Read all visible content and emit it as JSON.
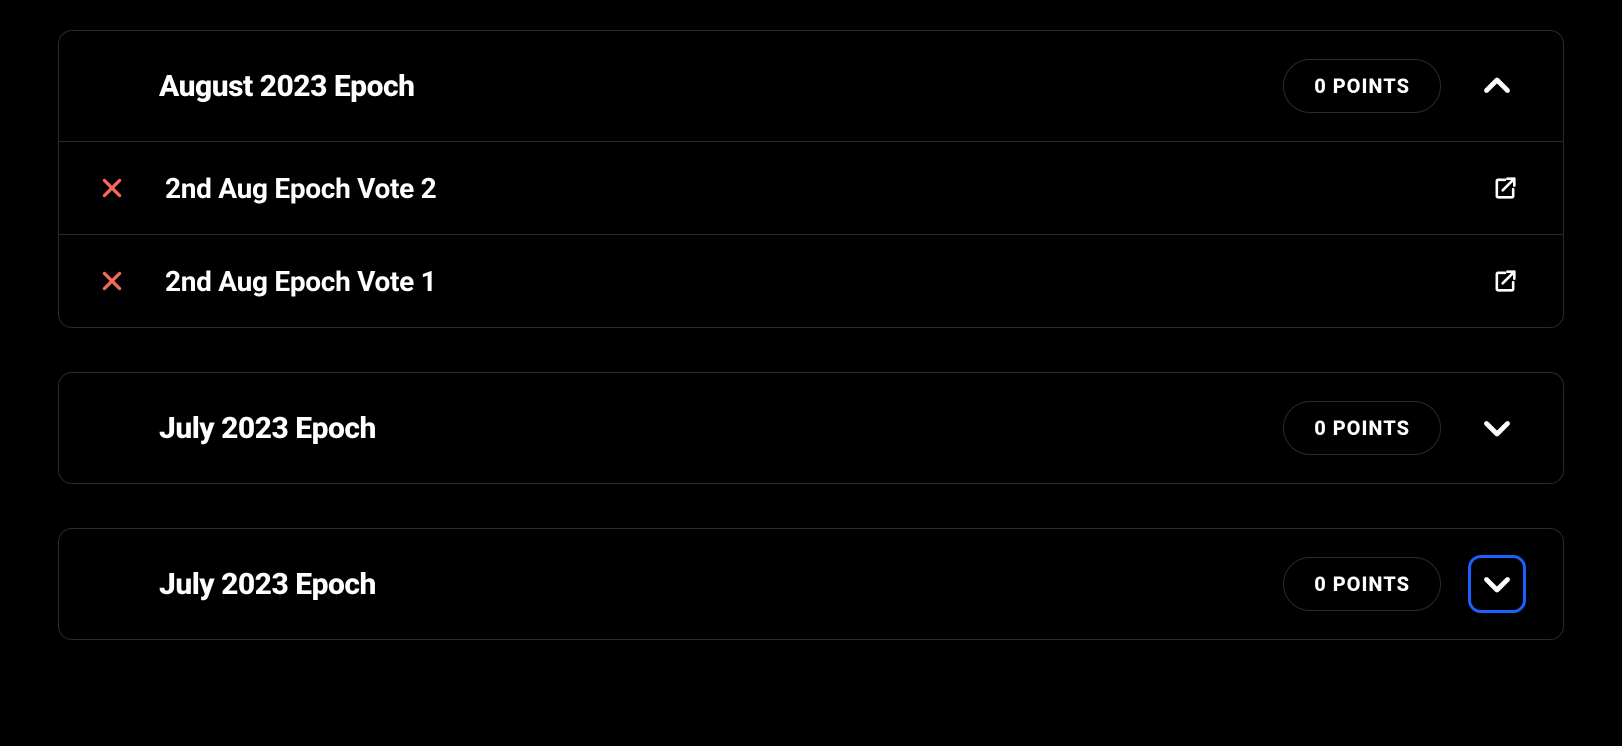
{
  "epochs": [
    {
      "title": "August 2023 Epoch",
      "points_label": "0 POINTS",
      "expanded": true,
      "focused": false,
      "votes": [
        {
          "label": "2nd Aug Epoch Vote 2",
          "status": "x"
        },
        {
          "label": "2nd Aug Epoch Vote 1",
          "status": "x"
        }
      ]
    },
    {
      "title": "July 2023 Epoch",
      "points_label": "0 POINTS",
      "expanded": false,
      "focused": false,
      "votes": []
    },
    {
      "title": "July 2023 Epoch",
      "points_label": "0 POINTS",
      "expanded": false,
      "focused": true,
      "votes": []
    }
  ],
  "colors": {
    "x_icon": "#f26a5a",
    "focus_ring": "#1e5fff",
    "border": "#2a2a2a"
  }
}
